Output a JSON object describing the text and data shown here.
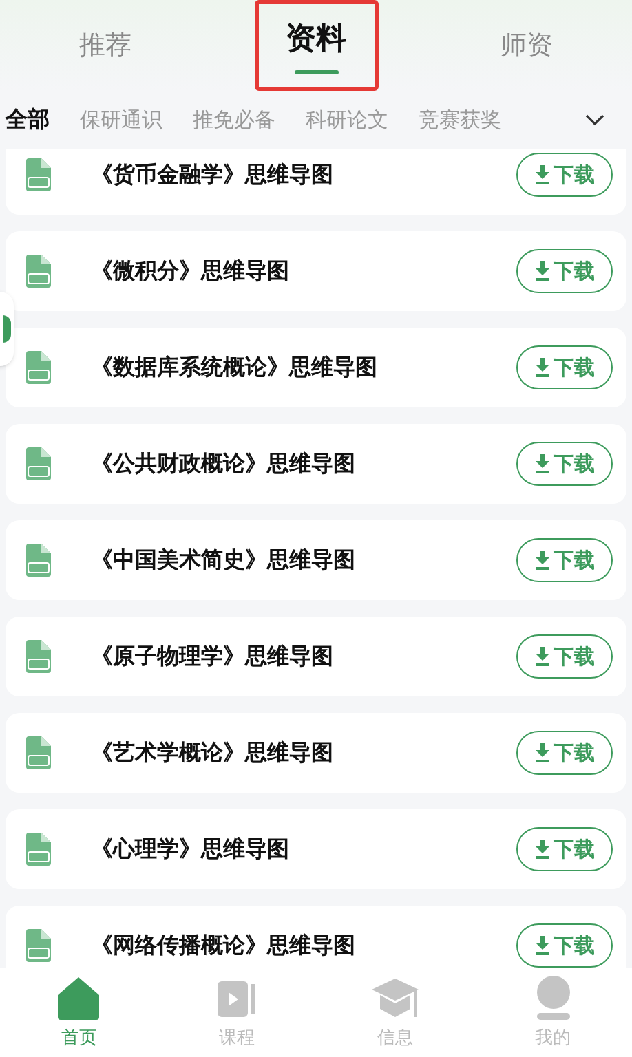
{
  "tabs": [
    {
      "label": "推荐",
      "selected": false
    },
    {
      "label": "资料",
      "selected": true
    },
    {
      "label": "师资",
      "selected": false
    }
  ],
  "categories": [
    {
      "label": "全部",
      "selected": true
    },
    {
      "label": "保研通识",
      "selected": false
    },
    {
      "label": "推免必备",
      "selected": false
    },
    {
      "label": "科研论文",
      "selected": false
    },
    {
      "label": "竞赛获奖",
      "selected": false
    }
  ],
  "files": [
    {
      "title": "《货币金融学》思维导图",
      "action": "下载"
    },
    {
      "title": "《微积分》思维导图",
      "action": "下载"
    },
    {
      "title": "《数据库系统概论》思维导图",
      "action": "下载"
    },
    {
      "title": "《公共财政概论》思维导图",
      "action": "下载"
    },
    {
      "title": "《中国美术简史》思维导图",
      "action": "下载"
    },
    {
      "title": "《原子物理学》思维导图",
      "action": "下载"
    },
    {
      "title": "《艺术学概论》思维导图",
      "action": "下载"
    },
    {
      "title": "《心理学》思维导图",
      "action": "下载"
    },
    {
      "title": "《网络传播概论》思维导图",
      "action": "下载"
    }
  ],
  "nav": [
    {
      "label": "首页",
      "kind": "home",
      "selected": true
    },
    {
      "label": "课程",
      "kind": "video",
      "selected": false
    },
    {
      "label": "信息",
      "kind": "cap",
      "selected": false
    },
    {
      "label": "我的",
      "kind": "user",
      "selected": false
    }
  ]
}
